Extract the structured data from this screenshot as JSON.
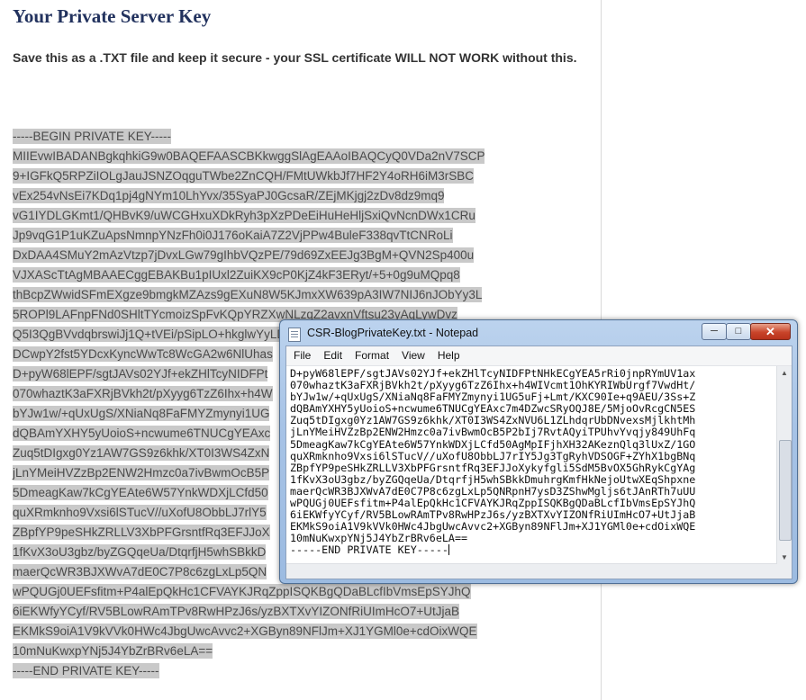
{
  "page": {
    "title": "Your Private Server Key",
    "warning": "Save this as a .TXT file and keep it secure - your SSL certificate WILL NOT WORK without this."
  },
  "key_lines": [
    "-----BEGIN PRIVATE KEY-----",
    "MIIEvwIBADANBgkqhkiG9w0BAQEFAASCBKkwggSlAgEAAoIBAQCyQ0VDa2nV7SCP",
    "9+IGFkQ5RPZiIOLgJauJSNZOqguTWbe2ZnCQH/FMtUWkbJf7HF2Y4oRH6iM3rSBC",
    "vEx254vNsEi7KDq1pj4gNYm10LhYvx/35SyaPJ0GcsaR/ZEjMKjgj2zDv8dz9mq9",
    "vG1IYDLGKmt1/QHBvK9/uWCGHxuXDkRyh3pXzPDeEiHuHeHljSxiQvNcnDWx1CRu",
    "Jp9vqG1P1uKZuApsNmnpYNzFh0i0J176oKaiA7Z2VjPPw4BuleF338qvTtCNRoLi",
    "DxDAA4SMuY2mAzVtzp7jDvxLGw79gIhbVQzPE/79d69ZxEEJg3BgM+QVN2Sp400u",
    "VJXAScTtAgMBAAECggEBAKBu1pIUxl2ZuiKX9cP0KjZ4kF3ERyt/+5+0g9uMQpq8",
    "thBcpZWwidSFmEXgze9bmgkMZAzs9gEXuN8W5KJmxXW639pA3IW7NIJ6nJObYy3L",
    "5ROPl9LAFnpFNd0SHltTYcmoizSpFvKQpYRZXwNLzqZ2avxnVftsu23yAqLywDvz",
    "Q5I3QgBVvdqbrswiJj1Q+tVEi/pSipLO+hkglwYyLDw",
    "DCwpY2fst5YDcxKyncWwTc8WcGA2w6NlUhas",
    "D+pyW68lEPF/sgtJAVs02YJf+ekZHlTcyNIDFPt",
    "070whaztK3aFXRjBVkh2t/pXyyg6TzZ6Ihx+h4W",
    "bYJw1w/+qUxUgS/XNiaNq8FaFMYZmynyi1UG",
    "dQBAmYXHY5yUoioS+ncwume6TNUCgYEAxc",
    "Zuq5tDIgxg0Yz1AW7GS9z6khk/XT0I3WS4ZxN",
    "jLnYMeiHVZzBp2ENW2Hmzc0a7ivBwmOcB5P",
    "5DmeagKaw7kCgYEAte6W57YnkWDXjLCfd50",
    "quXRmknho9Vxsi6lSTucV//uXofU8ObbLJ7rlY5",
    "ZBpfYP9peSHkZRLLV3XbPFGrsntfRq3EFJJoX",
    "1fKvX3oU3gbz/byZGQqeUa/DtqrfjH5whSBkkD",
    "maerQcWR3BJXWvA7dE0C7P8c6zgLxLp5QN",
    "wPQUGj0UEFsfitm+P4alEpQkHc1CFVAYKJRqZppISQKBgQDaBLcfIbVmsEpSYJhQ",
    "6iEKWfyYCyf/RV5BLowRAmTPv8RwHPzJ6s/yzBXTXvYIZONfRiUImHcO7+UtJjaB",
    "EKMkS9oiA1V9kVVk0HWc4JbgUwcAvvc2+XGByn89NFlJm+XJ1YGMl0e+cdOixWQE",
    "10mNuKwxpYNj5J4YbZrBRv6eLA==",
    "-----END PRIVATE KEY-----"
  ],
  "notepad": {
    "title": "CSR-BlogPrivateKey.txt - Notepad",
    "buttons": {
      "minimize": "─",
      "maximize": "□",
      "close": "✕"
    },
    "menu": [
      "File",
      "Edit",
      "Format",
      "View",
      "Help"
    ],
    "lines": [
      "D+pyW68lEPF/sgtJAVs02YJf+ekZHlTcyNIDFPtNHkECgYEA5rRi0jnpRYmUV1ax",
      "070whaztK3aFXRjBVkh2t/pXyyg6TzZ6Ihx+h4WIVcmt1OhKYRIWbUrgf7VwdHt/",
      "bYJw1w/+qUxUgS/XNiaNq8FaFMYZmynyi1UG5uFj+Lmt/KXC90Ie+q9AEU/3Ss+Z",
      "dQBAmYXHY5yUoioS+ncwume6TNUCgYEAxc7m4DZwcSRyOQJ8E/5MjoOvRcgCN5ES",
      "Zuq5tDIgxg0Yz1AW7GS9z6khk/XT0I3WS4ZxNVU6L1ZLhdqrUbDNvexsMjlkhtMh",
      "jLnYMeiHVZzBp2ENW2Hmzc0a7ivBwmOcB5P2bIj7RvtAQyiTPUhvYvqjy849UhFq",
      "5DmeagKaw7kCgYEAte6W57YnkWDXjLCfd50AgMpIFjhXH32AKeznQlq3lUxZ/1GO",
      "quXRmknho9Vxsi6lSTucV//uXofU8ObbLJ7rIY5Jg3TgRyhVDSOGF+ZYhX1bgBNq",
      "ZBpfYP9peSHkZRLLV3XbPFGrsntfRq3EFJJoXykyfgli5SdM5BvOX5GhRykCgYAg",
      "1fKvX3oU3gbz/byZGQqeUa/DtqrfjH5whSBkkDmuhrgKmfHkNejoUtwXEqShpxne",
      "maerQcWR3BJXWvA7dE0C7P8c6zgLxLp5QNRpnH7ysD3ZShwMgljs6tJAnRTh7uUU",
      "wPQUGj0UEFsfitm+P4alEpQkHc1CFVAYKJRqZppISQKBgQDaBLcfIbVmsEpSYJhQ",
      "6iEKWfyYCyf/RV5BLowRAmTPv8RwHPzJ6s/yzBXTXvYIZONfRiUImHcO7+UtJjaB",
      "EKMkS9oiA1V9kVVk0HWc4JbgUwcAvvc2+XGByn89NFlJm+XJ1YGMl0e+cdOixWQE",
      "10mNuKwxpYNj5J4YbZrBRv6eLA==",
      "-----END PRIVATE KEY-----"
    ]
  }
}
